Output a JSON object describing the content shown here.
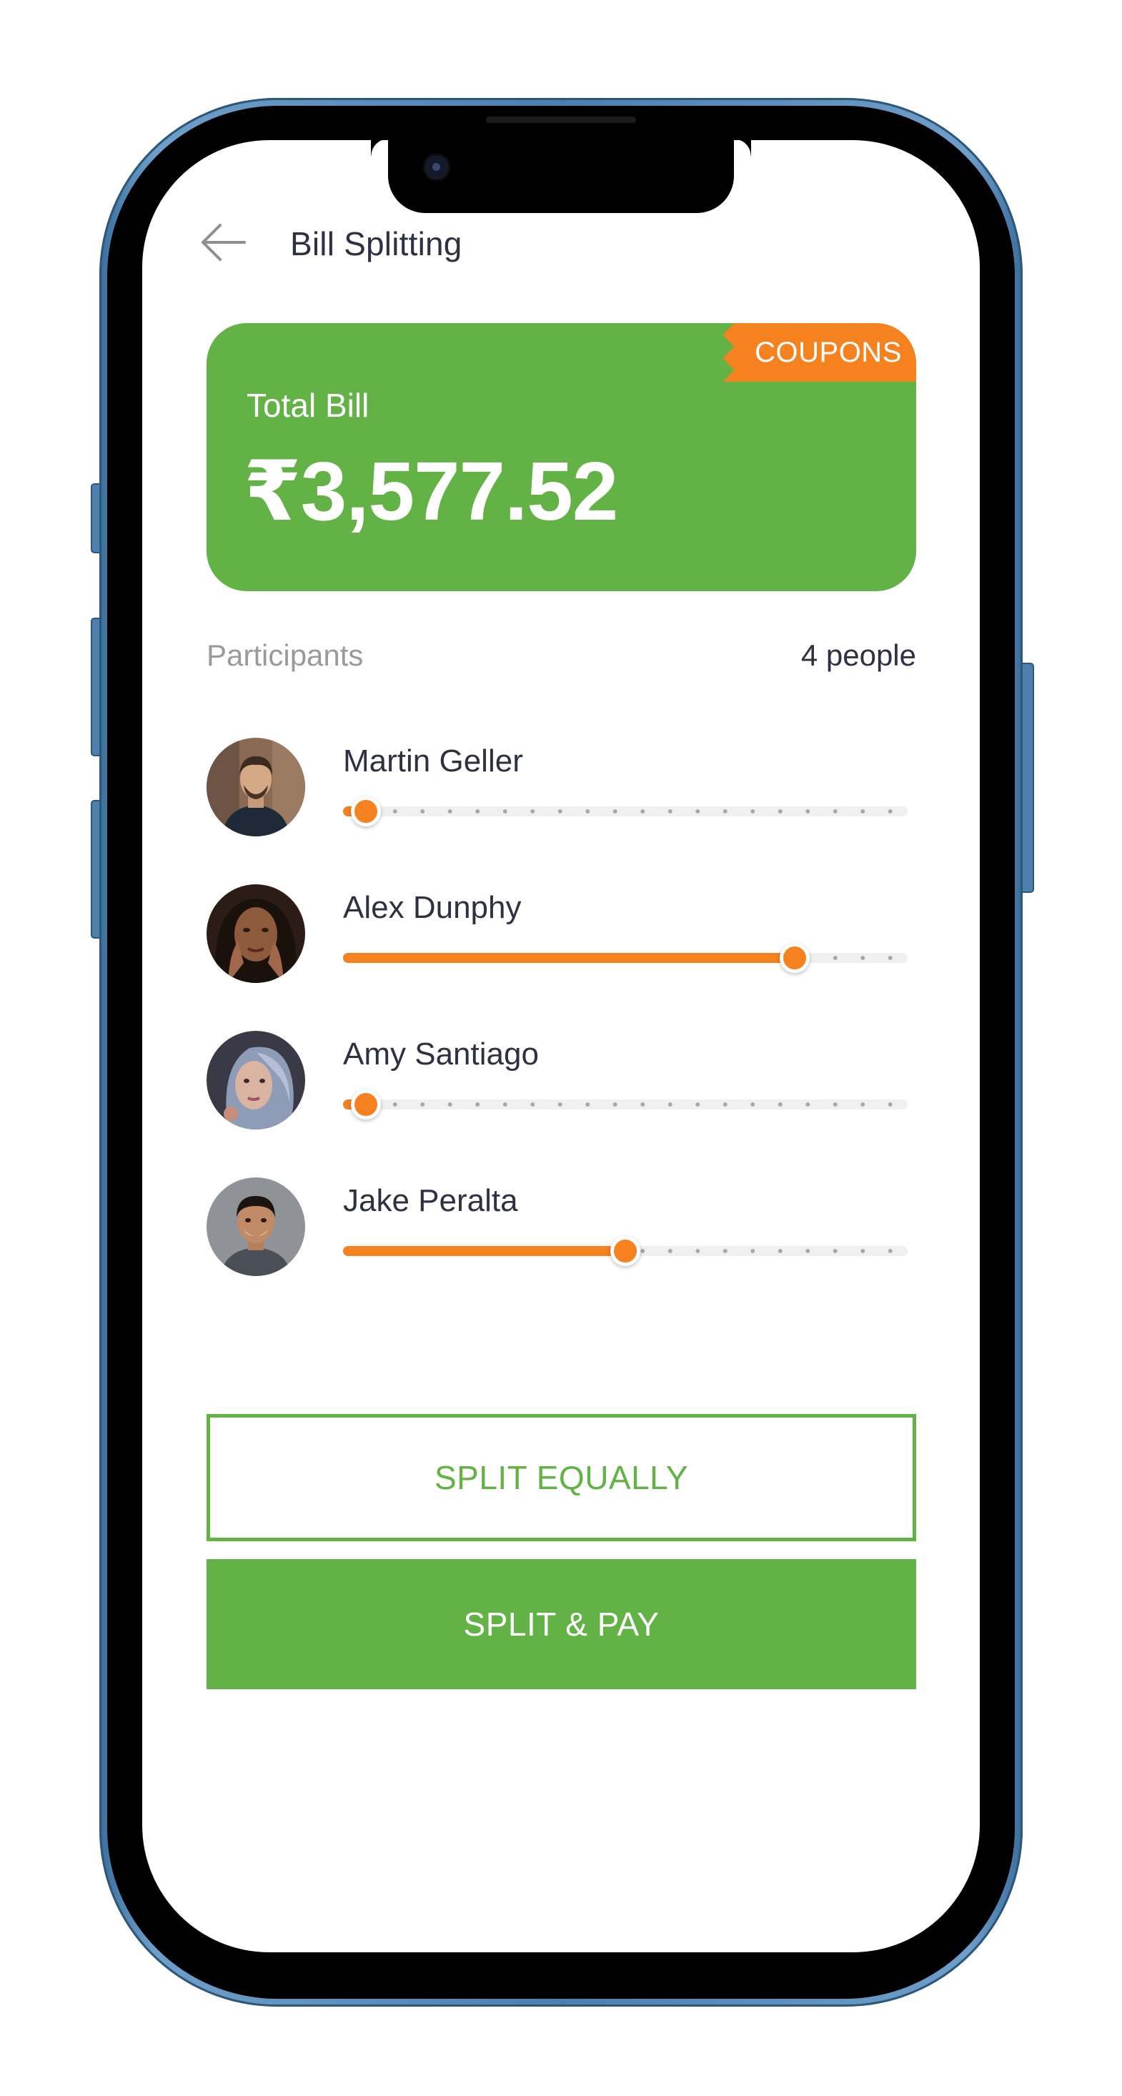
{
  "header": {
    "title": "Bill Splitting",
    "back_icon": "arrow-left-icon"
  },
  "total_card": {
    "label": "Total Bill",
    "amount": "₹3,577.52",
    "coupons_label": "COUPONS",
    "card_color": "#62b246",
    "coupon_color": "#f5821f"
  },
  "participants": {
    "label": "Participants",
    "count_text": "4 people",
    "items": [
      {
        "name": "Martin Geller",
        "share_percent": 4
      },
      {
        "name": "Alex Dunphy",
        "share_percent": 80
      },
      {
        "name": "Amy Santiago",
        "share_percent": 4
      },
      {
        "name": "Jake Peralta",
        "share_percent": 50
      }
    ]
  },
  "actions": {
    "split_equally_label": "SPLIT EQUALLY",
    "split_pay_label": "SPLIT & PAY"
  },
  "colors": {
    "accent_green": "#62b246",
    "accent_orange": "#f5821f",
    "text_dark": "#2d3142",
    "text_muted": "#9a9a9a"
  }
}
